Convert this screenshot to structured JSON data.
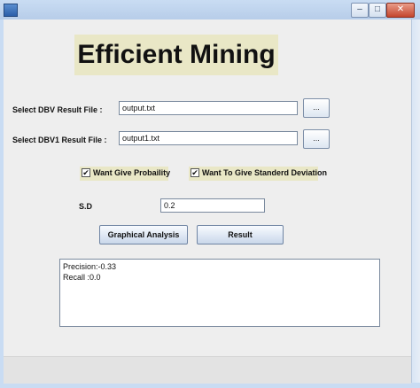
{
  "window": {
    "title": "",
    "min_glyph": "–",
    "max_glyph": "□",
    "close_glyph": "✕"
  },
  "heading": "Efficient Mining",
  "dbv": {
    "label": "Select DBV Result File :",
    "value": "output.txt",
    "browse": "..."
  },
  "dbv1": {
    "label": "Select  DBV1 Result File :",
    "value": "output1.txt",
    "browse": "..."
  },
  "options": {
    "probability": {
      "label": "Want Give Probaility",
      "checked": true,
      "mark": "✔"
    },
    "std_dev": {
      "label": "Want To Give Standerd Deviation",
      "checked": true,
      "mark": "✔"
    }
  },
  "sd": {
    "label": "S.D",
    "value": "0.2"
  },
  "buttons": {
    "graph": "Graphical Analysis",
    "result": "Result"
  },
  "output": {
    "lines": [
      "Precision:-0.33",
      "Recall :0.0"
    ]
  }
}
